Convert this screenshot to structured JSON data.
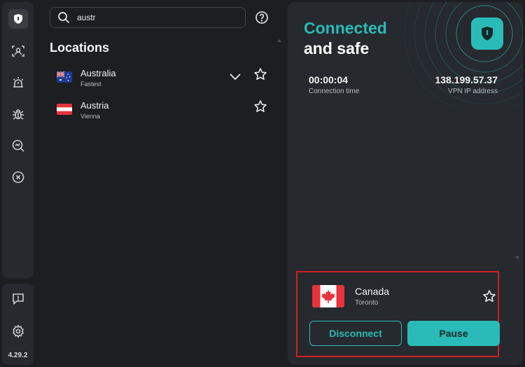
{
  "app": {
    "version": "4.29.2",
    "accent_color": "#2abbb8",
    "highlight_color": "#d31f24"
  },
  "sidebar": {
    "items": [
      {
        "icon": "shield-logo-icon"
      },
      {
        "icon": "face-scan-icon"
      },
      {
        "icon": "alarm-icon"
      },
      {
        "icon": "bug-icon"
      },
      {
        "icon": "search-chart-icon"
      },
      {
        "icon": "close-circle-icon"
      }
    ],
    "bottom_items": [
      {
        "icon": "feedback-icon"
      },
      {
        "icon": "gear-icon"
      }
    ]
  },
  "search": {
    "value": "austr",
    "icon": "search-icon"
  },
  "locations": {
    "title": "Locations",
    "items": [
      {
        "name": "Australia",
        "sub": "Fastest",
        "flag": "australia-flag",
        "expandable": true
      },
      {
        "name": "Austria",
        "sub": "Vienna",
        "flag": "austria-flag",
        "expandable": false
      }
    ]
  },
  "status": {
    "line1": "Connected",
    "line2": "and safe",
    "connection_time": "00:00:04",
    "connection_time_label": "Connection time",
    "ip": "138.199.57.37",
    "ip_label": "VPN IP address"
  },
  "server": {
    "country": "Canada",
    "city": "Toronto",
    "flag": "canada-flag",
    "disconnect_label": "Disconnect",
    "pause_label": "Pause"
  }
}
